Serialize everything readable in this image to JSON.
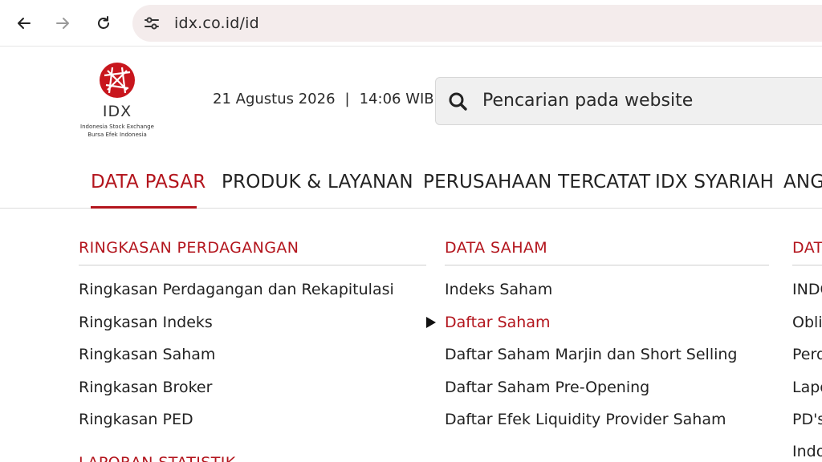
{
  "browser": {
    "url": "idx.co.id/id",
    "icons": [
      "back-arrow-icon",
      "forward-arrow-icon",
      "reload-icon",
      "site-settings-icon"
    ]
  },
  "header": {
    "logo": {
      "text": "IDX",
      "subtitle_line1": "Indonesia Stock Exchange",
      "subtitle_line2": "Bursa Efek Indonesia"
    },
    "date": "21 Agustus 2026",
    "separator": "|",
    "time": "14:06 WIB",
    "search": {
      "placeholder": "Pencarian pada website"
    }
  },
  "nav": {
    "items": [
      {
        "label": "DATA PASAR",
        "active": true
      },
      {
        "label": "PRODUK & LAYANAN"
      },
      {
        "label": "PERUSAHAAN TERCATAT"
      },
      {
        "label": "IDX SYARIAH"
      },
      {
        "label": "ANG"
      }
    ]
  },
  "menu": {
    "columns": [
      {
        "title": "RINGKASAN PERDAGANGAN",
        "links": [
          "Ringkasan Perdagangan dan Rekapitulasi",
          "Ringkasan Indeks",
          "Ringkasan Saham",
          "Ringkasan Broker",
          "Ringkasan PED"
        ]
      },
      {
        "title": "DATA SAHAM",
        "links": [
          "Indeks Saham",
          "Daftar Saham",
          "Daftar Saham Marjin dan Short Selling",
          "Daftar Saham Pre-Opening",
          "Daftar Efek Liquidity Provider Saham"
        ],
        "active_index": 1
      },
      {
        "title": "DAT",
        "links": [
          "INDC",
          "Oblig",
          "Perd",
          "Lapo",
          "PD's",
          "Indo"
        ]
      }
    ],
    "next_section_title": "LAPORAN STATISTIK"
  },
  "colors": {
    "accent": "#b3151d",
    "url_bar": "#f4ecec",
    "search_bg": "#f0f0f0"
  }
}
